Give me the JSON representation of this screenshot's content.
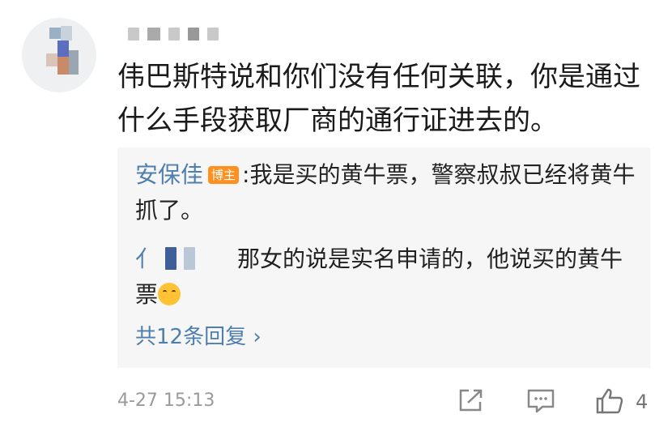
{
  "comment": {
    "text": "伟巴斯特说和你们没有任何关联，你是通过什么手段获取厂商的通行证进去的。"
  },
  "replies": {
    "first": {
      "name": "安保佳",
      "badge": "博主",
      "text": ":我是买的黄牛票，警察叔叔已经将黄牛抓了。"
    },
    "second": {
      "name_visible": "亻",
      "text": "那女的说是实名申请的，他说买的黄牛票"
    },
    "more_label": "共12条回复 ›"
  },
  "footer": {
    "time": "4-27 15:13",
    "like_count": "4"
  },
  "colors": {
    "link_blue": "#4f7fae",
    "badge_orange": "#ff8f1f",
    "reply_bg": "#f6f6f6"
  },
  "icons": [
    "share-icon",
    "comment-icon",
    "like-icon",
    "emoji-icon"
  ]
}
